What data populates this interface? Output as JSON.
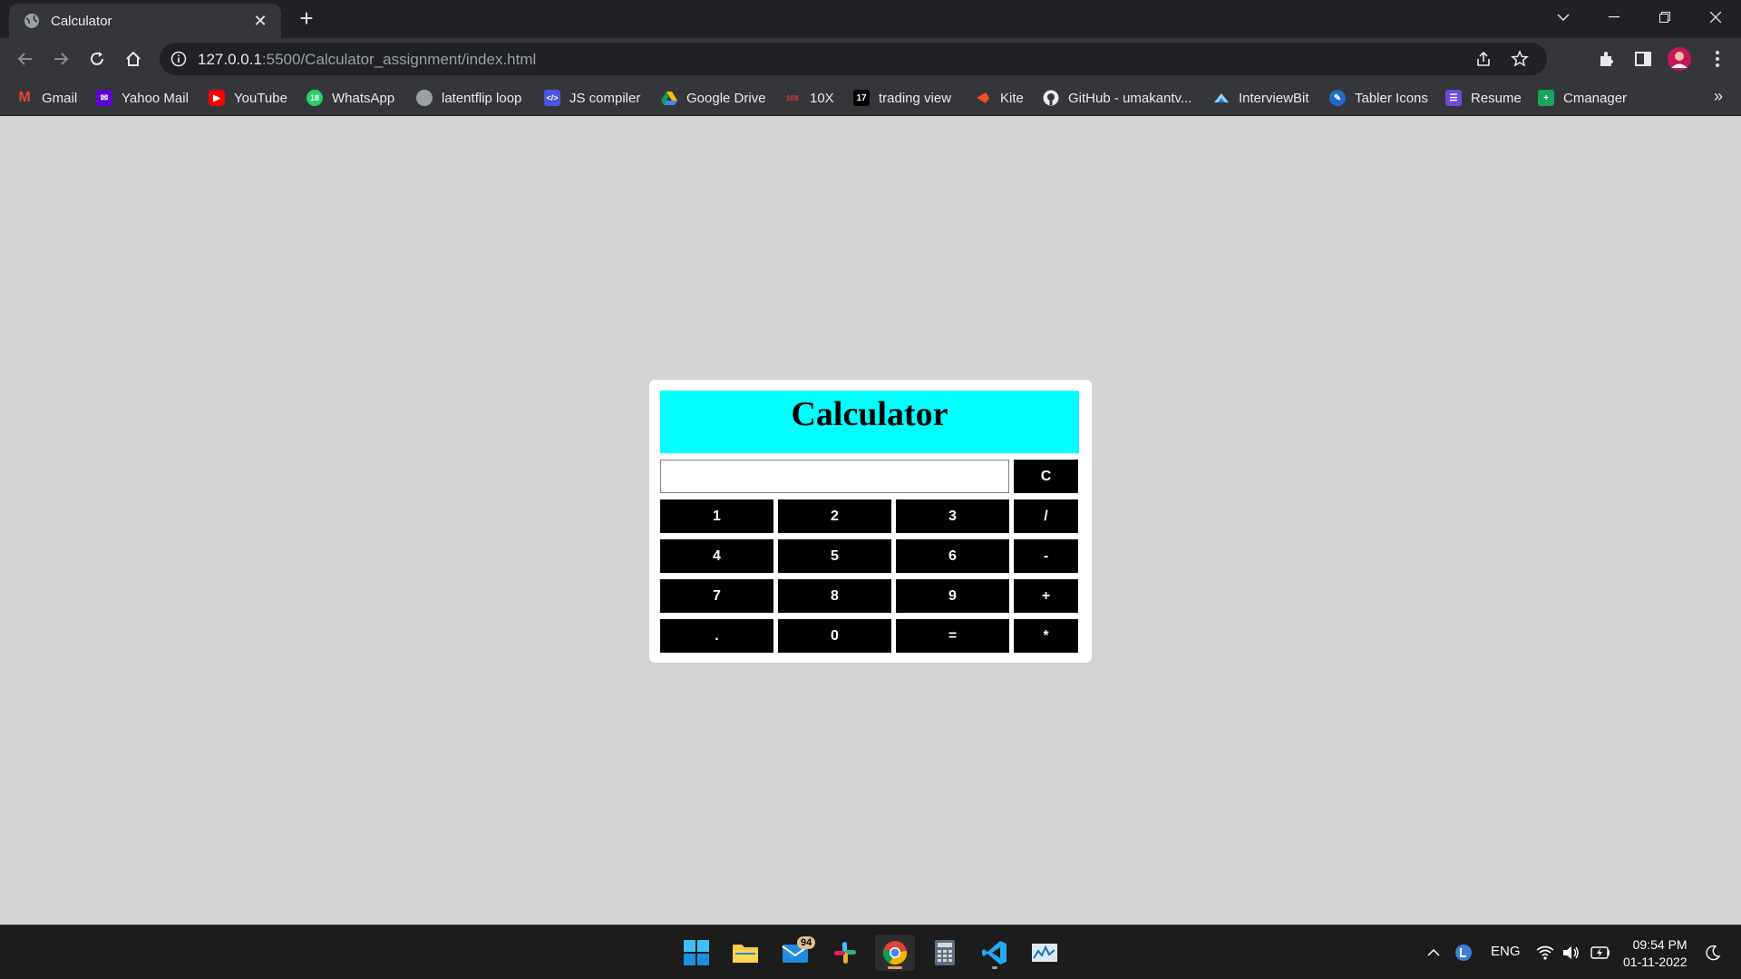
{
  "browser": {
    "tab": {
      "title": "Calculator"
    },
    "url": {
      "host": "127.0.0.1",
      "path": ":5500/Calculator_assignment/index.html"
    },
    "bookmarks": [
      {
        "label": "Gmail",
        "icon": "gmail-icon"
      },
      {
        "label": "Yahoo Mail",
        "icon": "yahoo-mail-icon"
      },
      {
        "label": "YouTube",
        "icon": "youtube-icon"
      },
      {
        "label": "WhatsApp",
        "icon": "whatsapp-icon"
      },
      {
        "label": "latentflip loop",
        "icon": "globe-icon"
      },
      {
        "label": "JS compiler",
        "icon": "code-icon"
      },
      {
        "label": "Google Drive",
        "icon": "google-drive-icon"
      },
      {
        "label": "10X",
        "icon": "tenx-icon"
      },
      {
        "label": "trading view",
        "icon": "tradingview-icon"
      },
      {
        "label": "Kite",
        "icon": "kite-icon"
      },
      {
        "label": "GitHub - umakantv...",
        "icon": "github-icon"
      },
      {
        "label": "InterviewBit",
        "icon": "interviewbit-icon"
      },
      {
        "label": "Tabler Icons",
        "icon": "tabler-icon"
      },
      {
        "label": "Resume",
        "icon": "resume-icon"
      },
      {
        "label": "Cmanager",
        "icon": "cmanager-icon"
      }
    ],
    "more_bookmarks": "»"
  },
  "calculator": {
    "title": "Calculator",
    "display_value": "",
    "clear_label": "C",
    "keys": [
      "1",
      "2",
      "3",
      "/",
      "4",
      "5",
      "6",
      "-",
      "7",
      "8",
      "9",
      "+",
      ".",
      "0",
      "=",
      "*"
    ]
  },
  "taskbar": {
    "mail_badge": "94",
    "language": "ENG",
    "time": "09:54 PM",
    "date": "01-11-2022"
  },
  "colors": {
    "page_background": "#d3d3d3",
    "header_cyan": "#00ffff",
    "key_black": "#000000"
  }
}
